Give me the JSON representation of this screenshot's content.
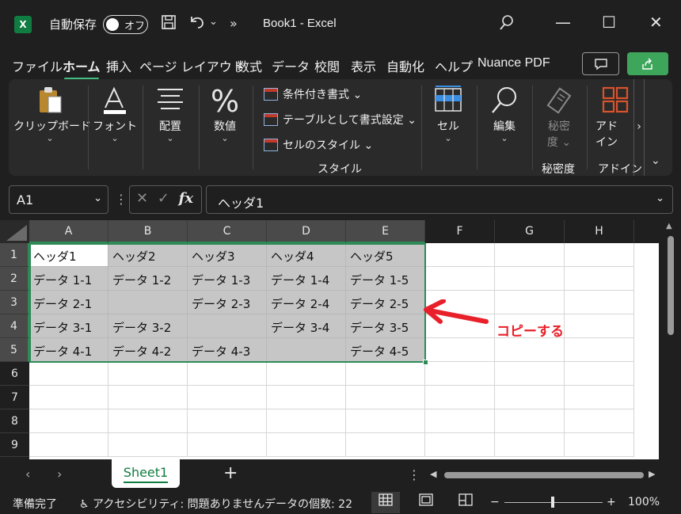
{
  "titlebar": {
    "app_logo": "X",
    "autosave_label": "自動保存",
    "autosave_state": "オフ",
    "title": "Book1  -  Excel",
    "more": "»",
    "undo_caret": "⌄",
    "minimize": "—",
    "maximize": "☐",
    "close": "✕"
  },
  "menu": {
    "tabs": [
      "ファイル",
      "ホーム",
      "挿入",
      "ページ レイアウト",
      "数式",
      "データ",
      "校閲",
      "表示",
      "自動化",
      "ヘルプ",
      "Nuance PDF"
    ],
    "active_tab": "ホーム"
  },
  "ribbon": {
    "clipboard": "クリップボード",
    "font": "フォント",
    "alignment": "配置",
    "number": "数値",
    "conditional_format": "条件付き書式 ⌄",
    "format_as_table": "テーブルとして書式設定 ⌄",
    "cell_styles": "セルのスタイル ⌄",
    "styles_group": "スタイル",
    "cells": "セル",
    "editing": "編集",
    "sensitivity_1": "秘密",
    "sensitivity_2": "度 ⌄",
    "sensitivity_group": "秘密度",
    "addin_1": "アド",
    "addin_2": "イン",
    "addin_group": "アドイン",
    "caret": "⌄",
    "more_right": "›",
    "collapse": "⌄"
  },
  "formula_bar": {
    "name_box": "A1",
    "fx": "fx",
    "formula": "ヘッダ1"
  },
  "grid": {
    "columns": [
      "A",
      "B",
      "C",
      "D",
      "E",
      "F",
      "G",
      "H"
    ],
    "rows": [
      "1",
      "2",
      "3",
      "4",
      "5",
      "6",
      "7",
      "8",
      "9"
    ],
    "cells": [
      [
        "ヘッダ1",
        "ヘッダ2",
        "ヘッダ3",
        "ヘッダ4",
        "ヘッダ5"
      ],
      [
        "データ 1-1",
        "データ 1-2",
        "データ 1-3",
        "データ 1-4",
        "データ 1-5"
      ],
      [
        "データ 2-1",
        "",
        "データ 2-3",
        "データ 2-4",
        "データ 2-5"
      ],
      [
        "データ 3-1",
        "データ 3-2",
        "",
        "データ 3-4",
        "データ 3-5"
      ],
      [
        "データ 4-1",
        "データ 4-2",
        "データ 4-3",
        "",
        "データ 4-5"
      ]
    ]
  },
  "annotation": "コピーする",
  "annotation_color": "#e8202a",
  "sheets": {
    "active": "Sheet1",
    "add": "+",
    "menu": "⋮"
  },
  "status": {
    "ready": "準備完了",
    "accessibility": "アクセシビリティ: 問題ありません",
    "count": "データの個数: 22",
    "zoom_minus": "−",
    "zoom_plus": "+",
    "zoom": "100%"
  }
}
